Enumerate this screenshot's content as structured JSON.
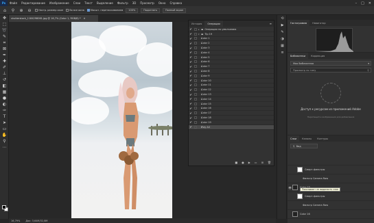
{
  "menubar": {
    "logo": "Ps",
    "items": [
      "Файл",
      "Редактирование",
      "Изображение",
      "Слои",
      "Текст",
      "Выделение",
      "Фильтр",
      "3D",
      "Просмотр",
      "Окно",
      "Справка"
    ]
  },
  "optionsbar": {
    "resize_windows": "Настр. размер окон",
    "all_windows": "Во все окна",
    "scrubby_zoom": "Масшт. перетаскиванием",
    "zoom_level": "100%",
    "fit_screen": "Подогнать",
    "fill_screen": "Полный экран"
  },
  "document": {
    "tab_title": "shutterstock_1184298061.jpg @ 16,7% (Color 1, RGB/8) *",
    "zoom": "16,79%",
    "doc_size": "Док: 3,64М/32,8М"
  },
  "actions_panel": {
    "tabs": [
      "История",
      "Операции"
    ],
    "root_label": "Операции по умолчанию",
    "set_label": "Tip 19",
    "items": [
      "Color 1",
      "Color 2",
      "Color 3",
      "Color 4",
      "Color 5",
      "Color 6",
      "Color 7",
      "Color 8",
      "Color 9",
      "Color 10",
      "Color 11",
      "Color 12",
      "Color 13",
      "Color 14",
      "Color 15",
      "Color 16",
      "Color 17",
      "Color 18",
      "Color 19",
      "Play All"
    ]
  },
  "histogram_panel": {
    "tabs": [
      "Гистограмма",
      "Навигатор"
    ]
  },
  "libraries_panel": {
    "tabs": [
      "Библиотеки",
      "Коррекция"
    ],
    "dropdown": "Моя библиотека",
    "search_placeholder": "Просмотр по типу",
    "message": "Доступ к ресурсам из приложений Adobe",
    "sub_message": "Перетащите изображения для добавления"
  },
  "layers_panel": {
    "tabs": [
      "Слои",
      "Каналы",
      "Контуры"
    ],
    "filter_label": "Вид",
    "layers": [
      {
        "name": "Смарт-фильтры"
      },
      {
        "name": "Фильтр Camera Raw"
      },
      {
        "name": "Color 13"
      },
      {
        "name": "Смарт-фильтры"
      },
      {
        "name": "Фильтр Camera Raw"
      },
      {
        "name": "Color 16"
      }
    ]
  },
  "tooltip": "Показывает не видимость слоя",
  "colors": {
    "accent": "#31a8ff",
    "panel": "#323232",
    "background": "#262626"
  }
}
